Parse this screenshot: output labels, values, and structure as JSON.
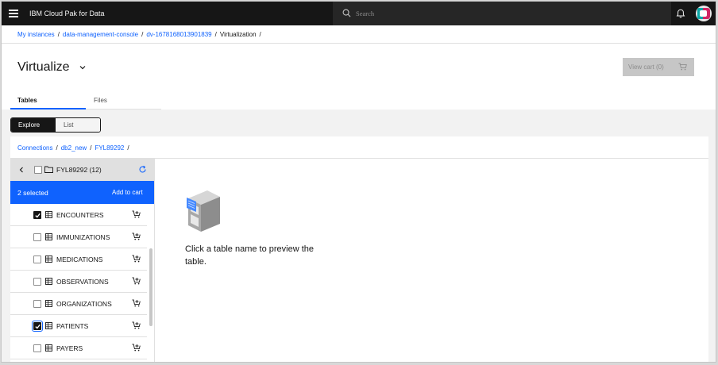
{
  "header": {
    "brand": "IBM Cloud Pak for Data",
    "search_placeholder": "Search",
    "icons": [
      "menu-icon",
      "search-icon",
      "notification-icon",
      "user-avatar"
    ]
  },
  "breadcrumb": [
    {
      "label": "My instances",
      "link": true
    },
    {
      "label": "data-management-console",
      "link": true
    },
    {
      "label": "dv-1678168013901839",
      "link": true
    },
    {
      "label": "Virtualization",
      "link": false
    }
  ],
  "page": {
    "title": "Virtualize",
    "view_cart_label": "View cart (0)"
  },
  "tabs": [
    {
      "label": "Tables",
      "active": true
    },
    {
      "label": "Files",
      "active": false
    }
  ],
  "view_switcher": {
    "explore": "Explore",
    "list": "List",
    "selected": "Explore"
  },
  "path": [
    {
      "label": "Connections"
    },
    {
      "label": "db2_new"
    },
    {
      "label": "FYL89292"
    }
  ],
  "tree": {
    "header_label": "FYL89292 (12)",
    "selection_text": "2 selected",
    "add_to_cart": "Add to cart",
    "rows": [
      {
        "label": "ENCOUNTERS",
        "checked": true
      },
      {
        "label": "IMMUNIZATIONS",
        "checked": false
      },
      {
        "label": "MEDICATIONS",
        "checked": false
      },
      {
        "label": "OBSERVATIONS",
        "checked": false
      },
      {
        "label": "ORGANIZATIONS",
        "checked": false
      },
      {
        "label": "PATIENTS",
        "checked": true
      },
      {
        "label": "PAYERS",
        "checked": false
      }
    ]
  },
  "preview": {
    "empty_message": "Click a table name to preview the table."
  },
  "colors": {
    "accent": "#0f62fe",
    "topbar": "#161616"
  }
}
